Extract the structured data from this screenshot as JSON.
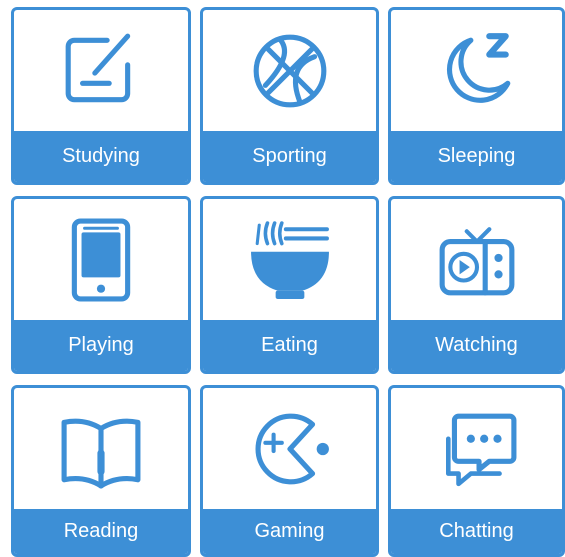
{
  "accent_color": "#3d8fd6",
  "tiles": [
    {
      "label": "Studying",
      "icon": "notepad-pencil-icon"
    },
    {
      "label": "Sporting",
      "icon": "basketball-icon"
    },
    {
      "label": "Sleeping",
      "icon": "moon-z-icon"
    },
    {
      "label": "Playing",
      "icon": "tablet-icon"
    },
    {
      "label": "Eating",
      "icon": "noodle-bowl-icon"
    },
    {
      "label": "Watching",
      "icon": "tv-play-icon"
    },
    {
      "label": "Reading",
      "icon": "open-book-icon"
    },
    {
      "label": "Gaming",
      "icon": "pacman-icon"
    },
    {
      "label": "Chatting",
      "icon": "chat-bubbles-icon"
    }
  ]
}
